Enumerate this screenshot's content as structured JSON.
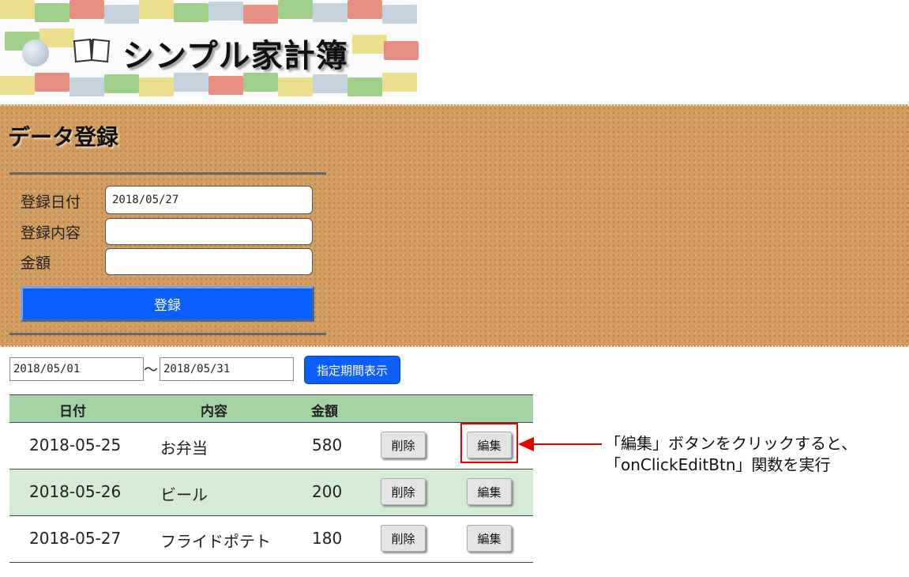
{
  "header": {
    "title": "シンプル家計簿"
  },
  "form": {
    "heading": "データ登録",
    "date_label": "登録日付",
    "date_value": "2018/05/27",
    "content_label": "登録内容",
    "content_value": "",
    "amount_label": "金額",
    "amount_value": "",
    "submit_label": "登録"
  },
  "filter": {
    "start_date": "2018/05/01",
    "separator": "〜",
    "end_date": "2018/05/31",
    "button_label": "指定期間表示"
  },
  "table": {
    "headers": {
      "date": "日付",
      "content": "内容",
      "amount": "金額"
    },
    "rows": [
      {
        "date": "2018-05-25",
        "content": "お弁当",
        "amount": "580",
        "delete": "削除",
        "edit": "編集"
      },
      {
        "date": "2018-05-26",
        "content": "ビール",
        "amount": "200",
        "delete": "削除",
        "edit": "編集"
      },
      {
        "date": "2018-05-27",
        "content": "フライドポテト",
        "amount": "180",
        "delete": "削除",
        "edit": "編集"
      }
    ]
  },
  "annotation": {
    "line1": "「編集」ボタンをクリックすると、",
    "line2": "「onClickEditBtn」関数を実行"
  },
  "colors": {
    "primary_button": "#0d5eff",
    "header_row": "#a6d3a6",
    "alt_row": "#d4ebd4",
    "annotation_red": "#e60000"
  },
  "icons": {
    "logo": "book-icon"
  }
}
